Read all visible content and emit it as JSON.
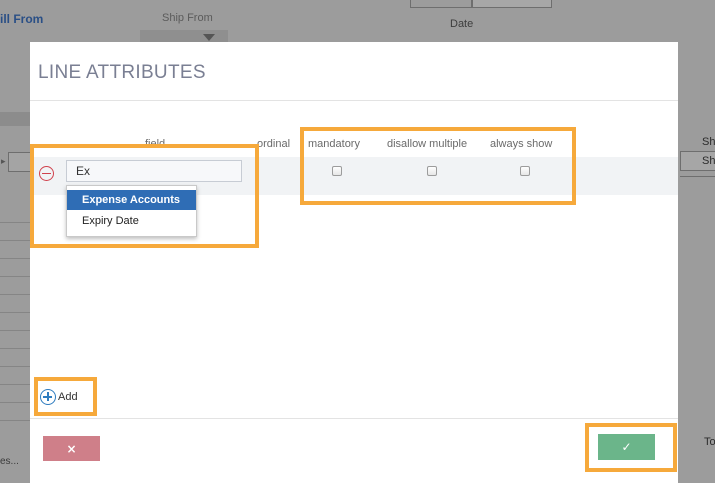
{
  "background": {
    "bill_from": "ill From",
    "ship_from": "Ship From",
    "date_label": "Date",
    "right_sh_1": "Sh",
    "right_sh_2": "Sh",
    "right_to": "To",
    "left_ellipsis": "es..."
  },
  "modal": {
    "title": "LINE ATTRIBUTES",
    "columns": {
      "field": "field",
      "ordinal": "ordinal",
      "mandatory": "mandatory",
      "disallow_multiple": "disallow multiple",
      "always_show": "always show"
    },
    "row": {
      "field_value": "Ex",
      "mandatory_checked": false,
      "disallow_multiple_checked": false,
      "always_show_checked": false
    },
    "autocomplete": [
      {
        "label": "Expense Accounts",
        "selected": true
      },
      {
        "label": "Expiry Date",
        "selected": false
      }
    ],
    "add_label": "Add",
    "cancel_label": "×",
    "confirm_label": "✓"
  },
  "colors": {
    "highlight": "#f6a93b",
    "cancel": "#cf7f89",
    "confirm": "#6bb58a",
    "selected_item": "#2f6db5"
  },
  "icons": [
    "remove-circle-icon",
    "add-circle-icon",
    "close-icon",
    "check-icon"
  ]
}
